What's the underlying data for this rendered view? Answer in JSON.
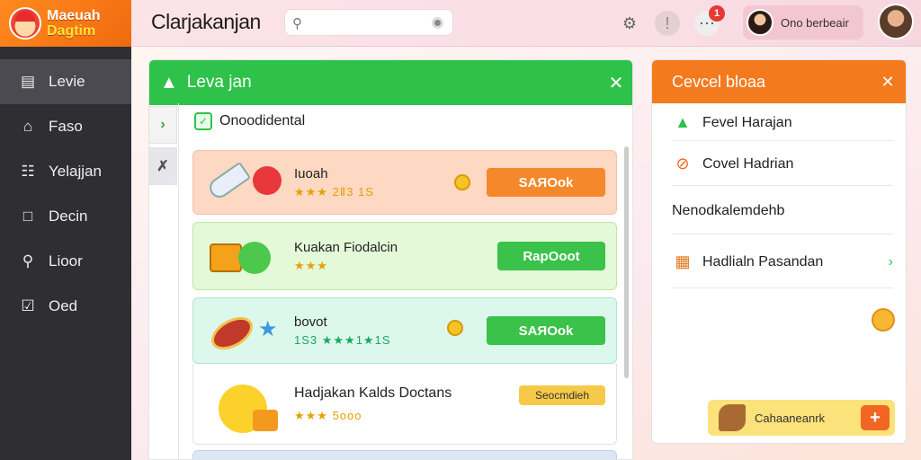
{
  "app": {
    "logo_line1": "Maeuah",
    "logo_line2": "Dagtim",
    "title": "Clarjakanjan"
  },
  "search": {
    "placeholder": "",
    "value": ""
  },
  "topbar": {
    "notifications_count": "1",
    "user_name": "Ono berbeair"
  },
  "sidebar": {
    "items": [
      {
        "label": "Levie",
        "icon": "calendar-icon"
      },
      {
        "label": "Faso",
        "icon": "home-icon"
      },
      {
        "label": "Yelajjan",
        "icon": "people-icon"
      },
      {
        "label": "Decin",
        "icon": "folder-icon"
      },
      {
        "label": "Lioor",
        "icon": "search-icon"
      },
      {
        "label": "Oed",
        "icon": "inbox-icon"
      }
    ]
  },
  "main": {
    "title": "Leva jan",
    "subtitle": "Onoodidental",
    "cards": [
      {
        "title": "Iuoah",
        "stars": "★★★ 2Ⅱ3 1S",
        "button": "SAЯOok"
      },
      {
        "title": "Kuakan Fiodalcin",
        "stars": "★★★",
        "button": "RapOoot"
      },
      {
        "title": "bovot",
        "stars": "1S3 ★★★1★1S",
        "button": "SAЯOok"
      },
      {
        "title": "Hadjakan Kalds Doctans",
        "stars": "★★★ 5ooo",
        "button": "Seocmdieh"
      }
    ]
  },
  "right": {
    "title": "Cevcel bloaa",
    "items": [
      {
        "label": "Fevel Harajan",
        "icon": "tree-icon"
      },
      {
        "label": "Covel Hadrian",
        "icon": "cancel-circle-icon"
      },
      {
        "label": "Nenodkalemdehb",
        "icon": ""
      },
      {
        "label": "Hadlialn Pasandan",
        "icon": "gift-icon"
      }
    ],
    "footer_label": "Cahaaneanrk",
    "footer_button": "+"
  },
  "colors": {
    "accent_green": "#2ec24a",
    "accent_orange": "#f47a1e",
    "sidebar_bg": "#2e2e33"
  }
}
